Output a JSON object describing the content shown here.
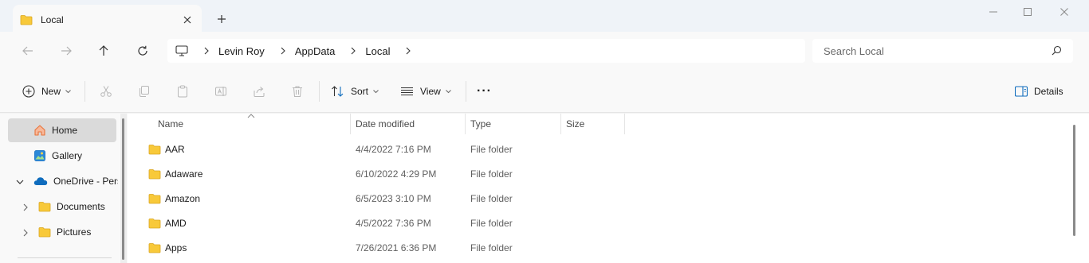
{
  "tab": {
    "title": "Local",
    "new_tab_label": "+"
  },
  "navigation": {
    "breadcrumbs": [
      "Levin Roy",
      "AppData",
      "Local"
    ]
  },
  "search": {
    "placeholder": "Search Local"
  },
  "toolbar": {
    "new_label": "New",
    "sort_label": "Sort",
    "view_label": "View",
    "more_label": "···",
    "details_label": "Details"
  },
  "sidebar": {
    "items": [
      {
        "label": "Home",
        "icon": "home-icon"
      },
      {
        "label": "Gallery",
        "icon": "gallery-icon"
      },
      {
        "label": "OneDrive - Personal",
        "icon": "onedrive-icon"
      },
      {
        "label": "Documents",
        "icon": "folder-icon"
      },
      {
        "label": "Pictures",
        "icon": "folder-icon"
      }
    ]
  },
  "table": {
    "columns": [
      "Name",
      "Date modified",
      "Type",
      "Size"
    ],
    "rows": [
      {
        "name": "AAR",
        "date": "4/4/2022 7:16 PM",
        "type": "File folder",
        "size": ""
      },
      {
        "name": "Adaware",
        "date": "6/10/2022 4:29 PM",
        "type": "File folder",
        "size": ""
      },
      {
        "name": "Amazon",
        "date": "6/5/2023 3:10 PM",
        "type": "File folder",
        "size": ""
      },
      {
        "name": "AMD",
        "date": "4/5/2022 7:36 PM",
        "type": "File folder",
        "size": ""
      },
      {
        "name": "Apps",
        "date": "7/26/2021 6:36 PM",
        "type": "File folder",
        "size": ""
      }
    ]
  },
  "colors": {
    "folder_yellow": "#f8c93a",
    "onedrive_blue": "#0f6cbd",
    "home_orange": "#e8743b",
    "selected_bg": "#dadada"
  }
}
